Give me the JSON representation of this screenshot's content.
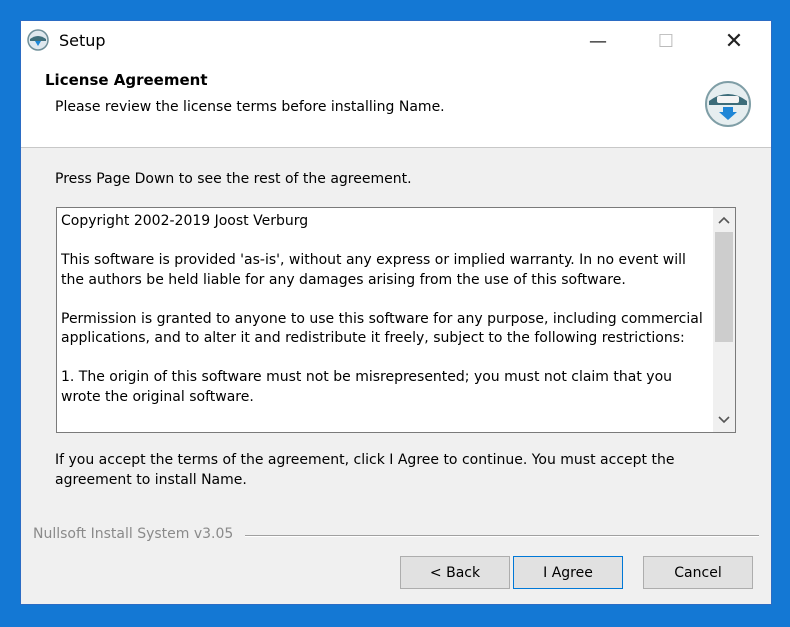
{
  "window": {
    "title": "Setup",
    "minimize_symbol": "—",
    "maximize_symbol": "☐",
    "close_symbol": "✕"
  },
  "header": {
    "title": "License Agreement",
    "subtitle": "Please review the license terms before installing Name."
  },
  "instruction": "Press Page Down to see the rest of the agreement.",
  "license": {
    "paragraphs": [
      "Copyright 2002-2019 Joost Verburg",
      "This software is provided 'as-is', without any express or implied warranty. In no event will the authors be held liable for any damages arising from the use of this software.",
      "Permission is granted to anyone to use this software for any purpose, including commercial applications, and to alter it and redistribute it freely, subject to the following restrictions:",
      "1. The origin of this software must not be misrepresented; you must not claim that you wrote the original software."
    ]
  },
  "accept_text": "If you accept the terms of the agreement, click I Agree to continue. You must accept the agreement to install Name.",
  "footer": {
    "brand": "Nullsoft Install System v3.05"
  },
  "buttons": {
    "back": "< Back",
    "agree": "I Agree",
    "cancel": "Cancel"
  },
  "icons": {
    "app": "installer-icon",
    "logo": "nsis-logo-icon",
    "scroll_up": "chevron-up-icon",
    "scroll_down": "chevron-down-icon"
  },
  "colors": {
    "desktop": "#1478d4",
    "accent": "#0078d7"
  }
}
